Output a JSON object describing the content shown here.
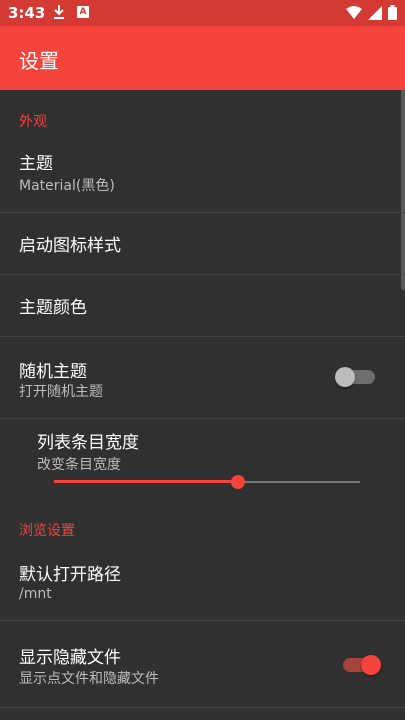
{
  "status_bar": {
    "time": "3:43",
    "notif_letter": "A"
  },
  "app_bar": {
    "title": "设置"
  },
  "sections": {
    "appearance": {
      "header": "外观",
      "theme": {
        "title": "主题",
        "subtitle": "Material(黑色)"
      },
      "launcher_icon_style": {
        "title": "启动图标样式"
      },
      "theme_color": {
        "title": "主题颜色"
      },
      "random_theme": {
        "title": "随机主题",
        "subtitle": "打开随机主题",
        "enabled": false
      },
      "list_item_width": {
        "title": "列表条目宽度",
        "subtitle": "改变条目宽度",
        "value_fraction": 0.6
      }
    },
    "browse": {
      "header": "浏览设置",
      "default_path": {
        "title": "默认打开路径",
        "subtitle": "/mnt"
      },
      "show_hidden": {
        "title": "显示隐藏文件",
        "subtitle": "显示点文件和隐藏文件",
        "enabled": true
      }
    }
  },
  "colors": {
    "accent": "#f4443c",
    "status_bar": "#d33a34",
    "background": "#303030"
  }
}
